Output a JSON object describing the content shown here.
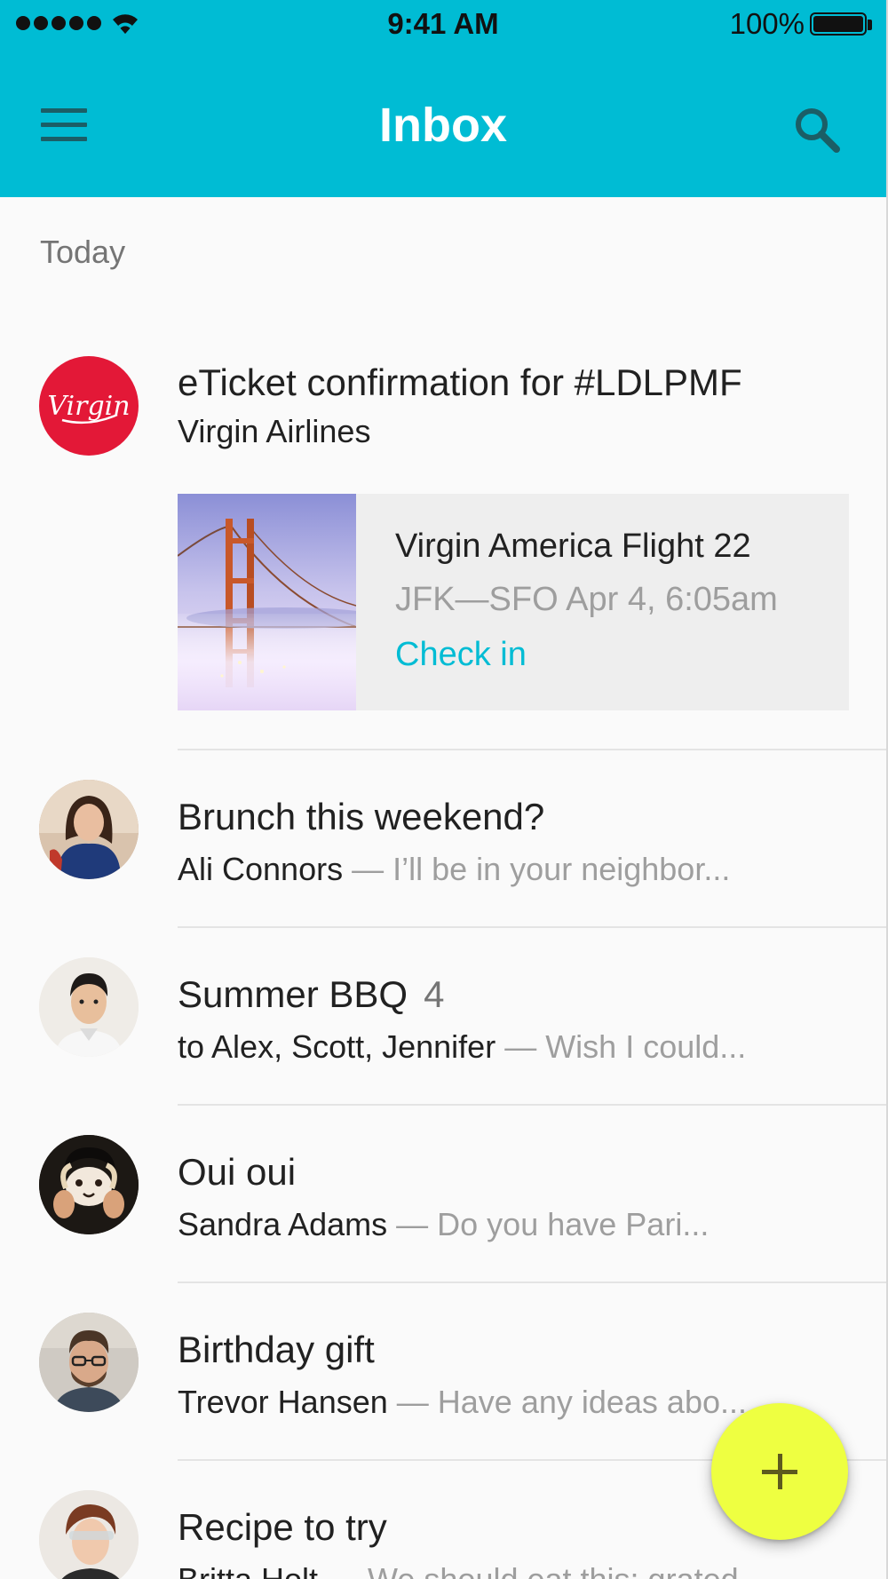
{
  "status_bar": {
    "time": "9:41 AM",
    "battery": "100%"
  },
  "app_bar": {
    "title": "Inbox",
    "menu_icon": "hamburger-menu-icon",
    "search_icon": "search-icon",
    "color": "#00bcd4"
  },
  "section": {
    "label": "Today"
  },
  "messages": [
    {
      "subject": "eTicket confirmation for #LDLPMF",
      "sender": "Virgin Airlines",
      "avatar": "virgin-logo",
      "card": {
        "title": "Virgin America Flight 22",
        "route": "JFK—SFO Apr 4, 6:05am",
        "action": "Check in",
        "image": "golden-gate-bridge-photo"
      }
    },
    {
      "subject": "Brunch this weekend?",
      "sender": "Ali Connors",
      "snippet": " — I’ll be in your neighbor..."
    },
    {
      "subject": "Summer BBQ",
      "count": "4",
      "sender": "to Alex, Scott, Jennifer",
      "snippet": " — Wish I could..."
    },
    {
      "subject": "Oui oui",
      "sender": "Sandra Adams",
      "snippet": " — Do you have Pari..."
    },
    {
      "subject": "Birthday gift",
      "sender": "Trevor Hansen",
      "snippet": " — Have any ideas abo..."
    },
    {
      "subject": "Recipe to try",
      "sender": "Britta Holt",
      "snippet": " — We should eat this: grated"
    }
  ],
  "fab": {
    "icon": "plus-icon",
    "color": "#eeff41"
  }
}
